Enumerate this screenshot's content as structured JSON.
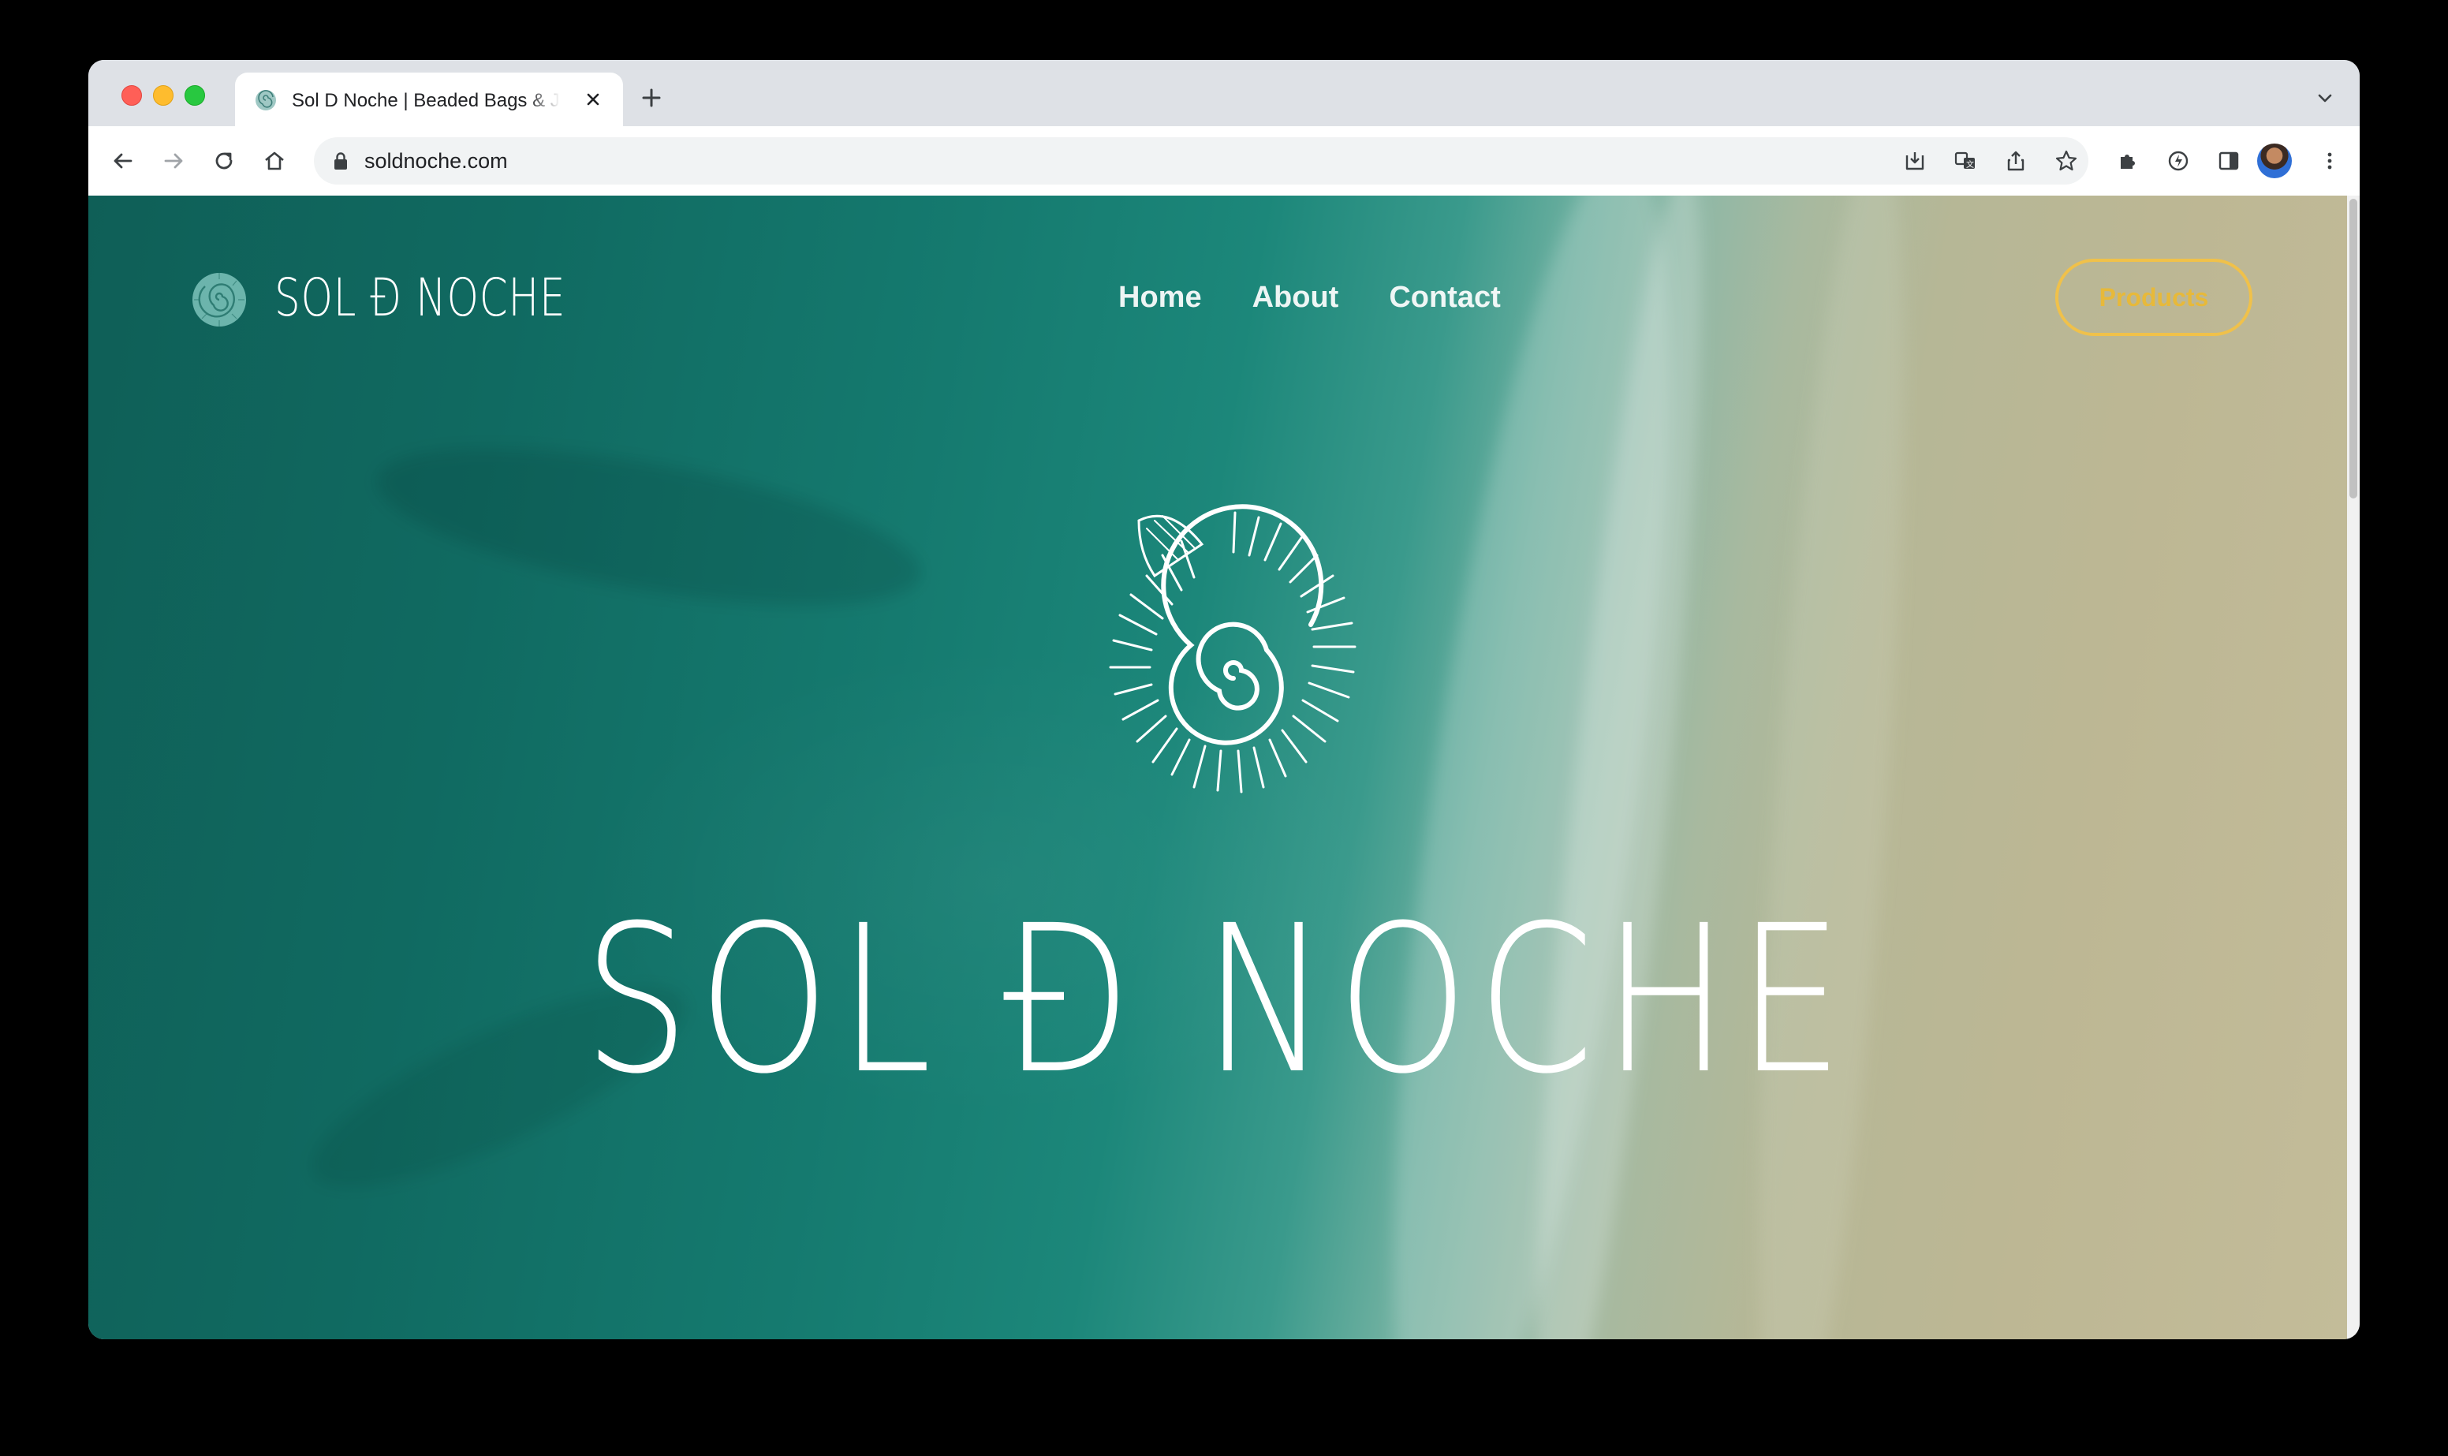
{
  "browser": {
    "tab_title": "Sol D Noche | Beaded Bags & Jewelry",
    "url": "soldnoche.com"
  },
  "site": {
    "brand_name": "SOL Ð NOCHE",
    "nav": [
      "Home",
      "About",
      "Contact"
    ],
    "products_label": "Products",
    "hero_title": "SOL Ð NOCHE"
  },
  "colors": {
    "accent": "#f0c14a",
    "sea": "#157a6f",
    "sand": "#bdb794"
  }
}
